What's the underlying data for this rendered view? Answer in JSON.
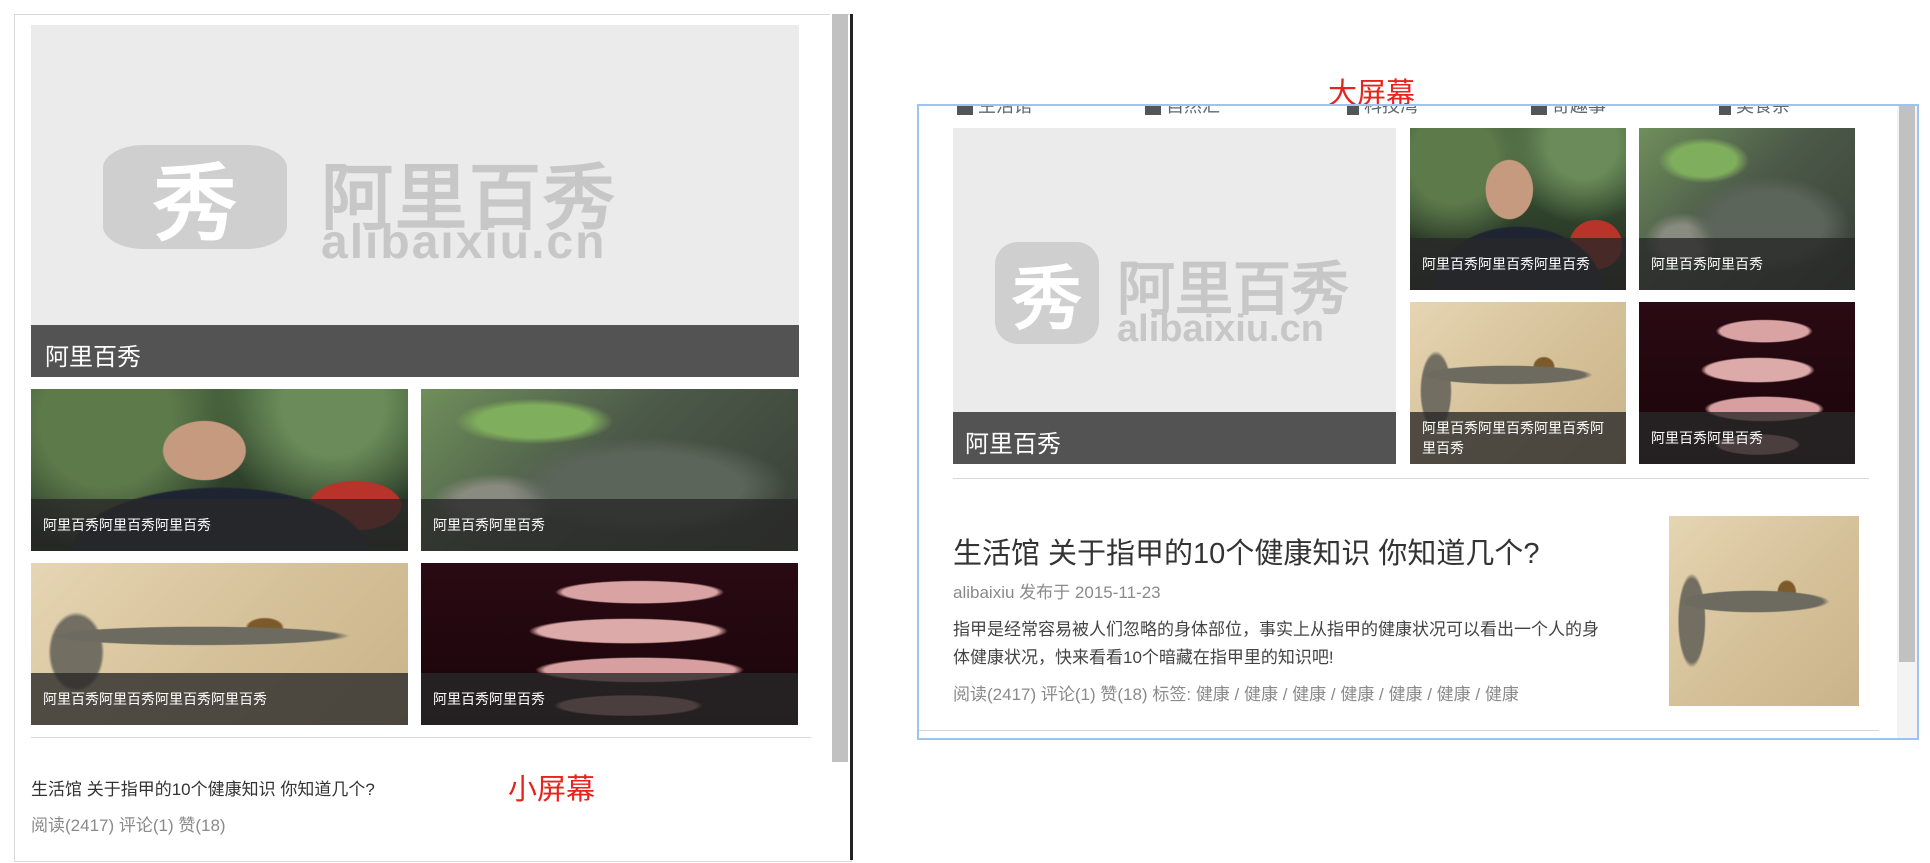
{
  "labels": {
    "small_screen": "小屏幕",
    "large_screen": "大屏幕"
  },
  "logo": {
    "emblem_char": "秀",
    "brand_cn": "阿里百秀",
    "brand_en": "alibaixiu.cn"
  },
  "nav_items": [
    "生活馆",
    "自然汇",
    "科技湾",
    "奇趣事",
    "美食杂"
  ],
  "featured": {
    "caption": "阿里百秀"
  },
  "small_screen": {
    "tiles": [
      {
        "photo": "man-portrait",
        "caption": "阿里百秀阿里百秀阿里百秀"
      },
      {
        "photo": "rock-landscape",
        "caption": "阿里百秀阿里百秀"
      },
      {
        "photo": "snake",
        "caption": "阿里百秀阿里百秀阿里百秀阿里百秀"
      },
      {
        "photo": "fingers",
        "caption": "阿里百秀阿里百秀"
      }
    ],
    "article": {
      "title": "生活馆 关于指甲的10个健康知识 你知道几个?",
      "stats": "阅读(2417) 评论(1) 赞(18)"
    }
  },
  "large_screen": {
    "tiles": [
      {
        "photo": "man-portrait",
        "caption": "阿里百秀阿里百秀阿里百秀"
      },
      {
        "photo": "rock-landscape",
        "caption": "阿里百秀阿里百秀"
      },
      {
        "photo": "snake",
        "caption": "阿里百秀阿里百秀阿里百秀阿里百秀"
      },
      {
        "photo": "fingers",
        "caption": "阿里百秀阿里百秀"
      }
    ],
    "article": {
      "title": "生活馆 关于指甲的10个健康知识 你知道几个?",
      "author": "alibaixiu",
      "published_label": "发布于",
      "date": "2015-11-23",
      "excerpt_line1": "指甲是经常容易被人们忽略的身体部位，事实上从指甲的健康状况可以看出一个人的身",
      "excerpt_line2": "体健康状况，快来看看10个暗藏在指甲里的知识吧!",
      "stats": "阅读(2417) 评论(1) 赞(18)",
      "tags_label": "标签:",
      "tags": [
        "健康",
        "健康",
        "健康",
        "健康",
        "健康",
        "健康",
        "健康"
      ],
      "thumbnail": "snake"
    }
  },
  "colors": {
    "label_red": "#e8231b",
    "panel_border": "#9cc3f2",
    "caption_bg": "#3c3c3c"
  }
}
